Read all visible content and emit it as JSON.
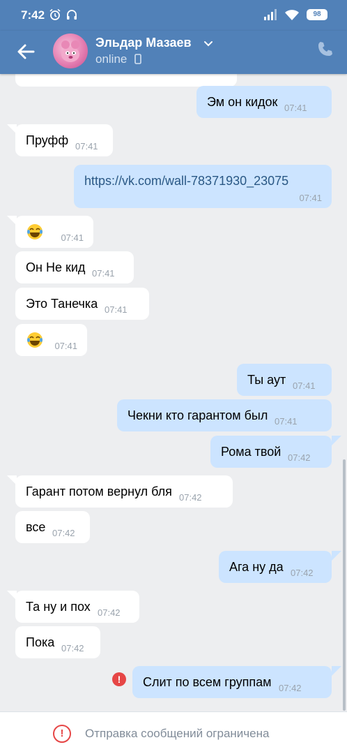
{
  "status_bar": {
    "time": "7:42",
    "battery": "98"
  },
  "header": {
    "name": "Эльдар Мазаев",
    "status": "online"
  },
  "messages": [
    {
      "dir": "out",
      "text": "Эм он кидок",
      "time": "07:41"
    },
    {
      "dir": "in",
      "text": "Пруфф",
      "time": "07:41"
    },
    {
      "dir": "out",
      "text": "https://vk.com/wall-78371930_23075",
      "time": "07:41"
    },
    {
      "dir": "in",
      "text": "",
      "emoji": "joy-emoji",
      "time": "07:41"
    },
    {
      "dir": "in",
      "text": "Он Не кид",
      "time": "07:41"
    },
    {
      "dir": "in",
      "text": "Это Танечка",
      "time": "07:41"
    },
    {
      "dir": "in",
      "text": "",
      "emoji": "joy-emoji",
      "time": "07:41"
    },
    {
      "dir": "out",
      "text": "Ты аут",
      "time": "07:41"
    },
    {
      "dir": "out",
      "text": "Чекни кто гарантом был",
      "time": "07:41"
    },
    {
      "dir": "out",
      "text": "Рома твой",
      "time": "07:42"
    },
    {
      "dir": "in",
      "text": "Гарант потом вернул бля",
      "time": "07:42"
    },
    {
      "dir": "in",
      "text": "все",
      "time": "07:42"
    },
    {
      "dir": "out",
      "text": "Ага ну да",
      "time": "07:42"
    },
    {
      "dir": "in",
      "text": "Та ну и пох",
      "time": "07:42"
    },
    {
      "dir": "in",
      "text": "Пока",
      "time": "07:42"
    },
    {
      "dir": "out",
      "text": "Слит по всем группам",
      "time": "07:42",
      "failed": true
    }
  ],
  "footer": {
    "notice": "Отправка сообщений ограничена"
  },
  "colors": {
    "header": "#5181b8",
    "outgoing": "#cce4ff",
    "incoming": "#ffffff",
    "error": "#e64646"
  }
}
